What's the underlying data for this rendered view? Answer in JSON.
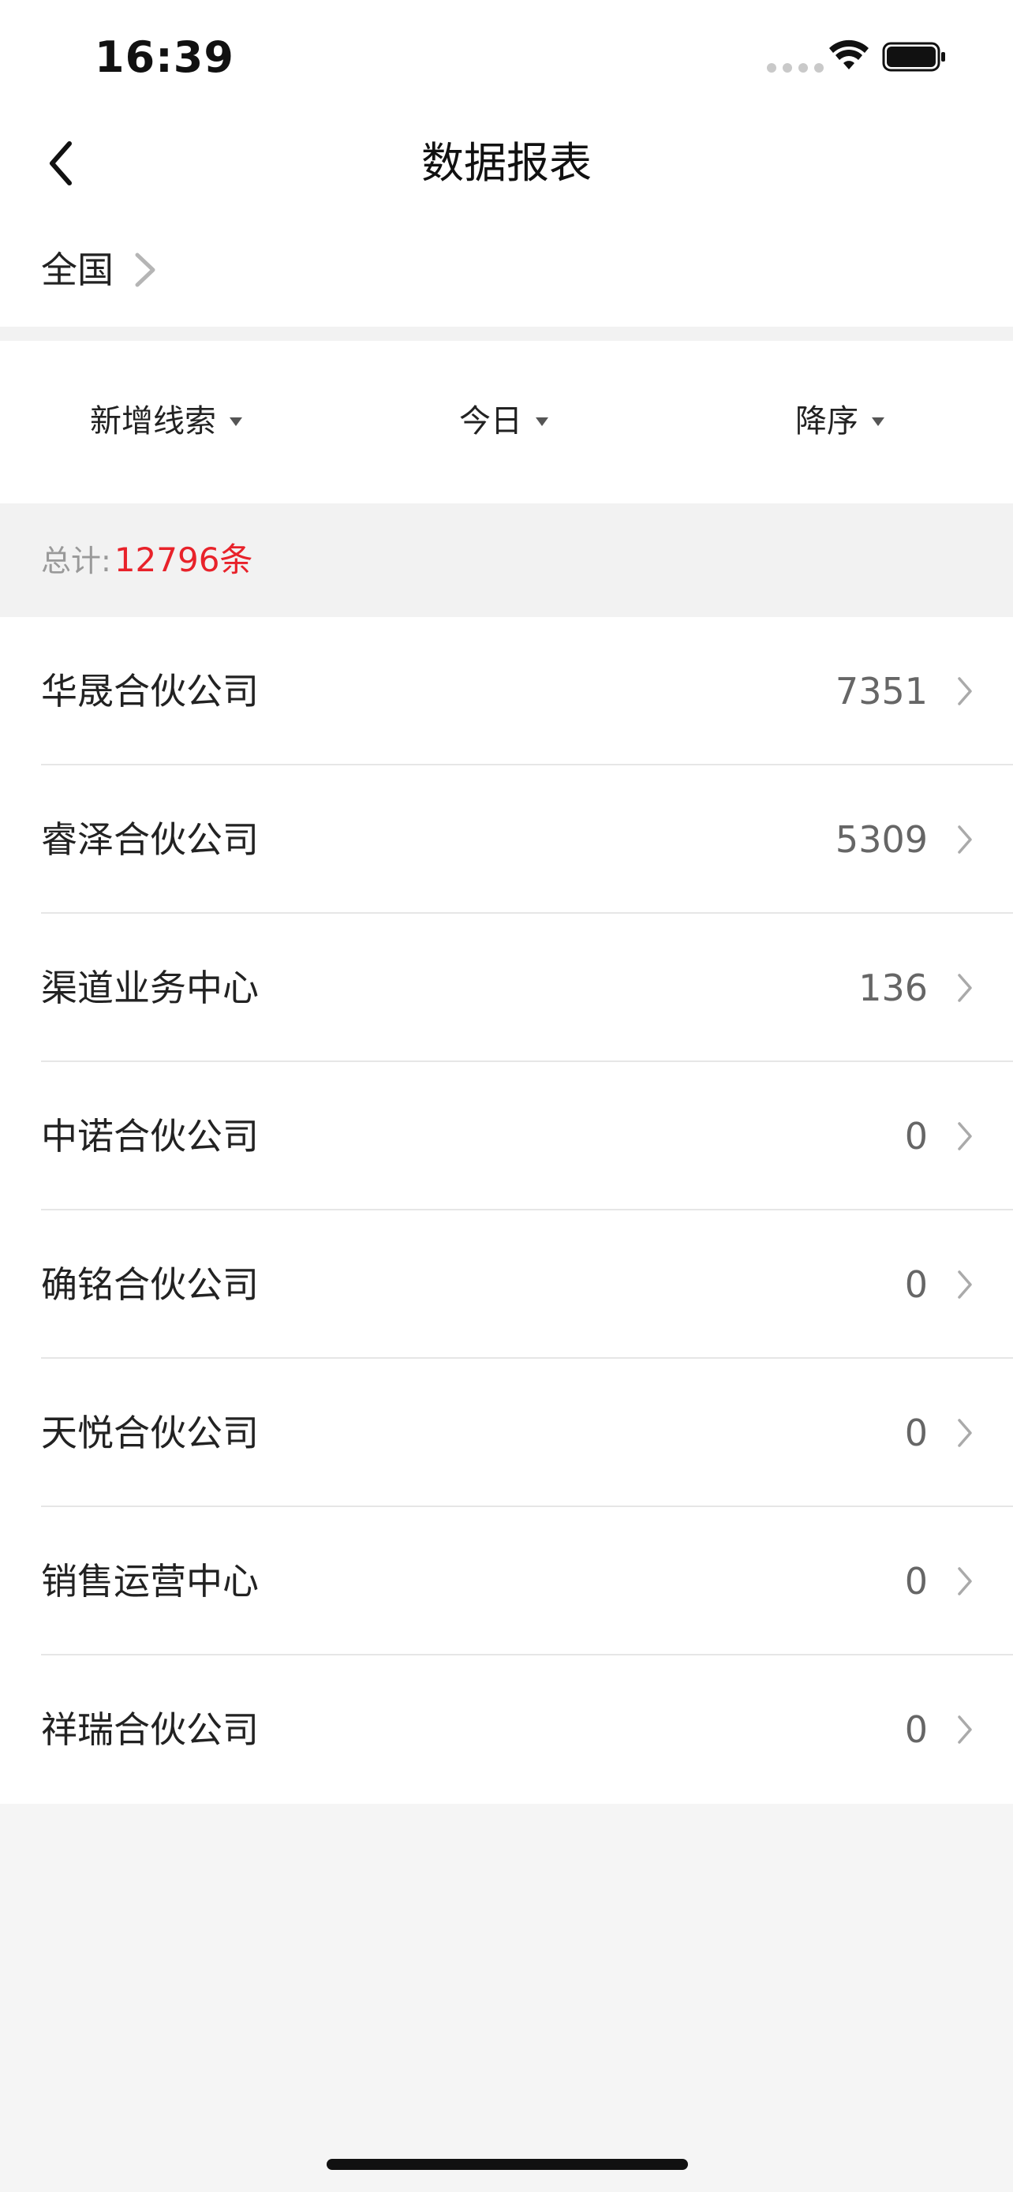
{
  "status_bar": {
    "time": "16:39"
  },
  "nav": {
    "title": "数据报表",
    "back_icon": "chevron-left-icon"
  },
  "region": {
    "label": "全国",
    "icon": "chevron-right-icon"
  },
  "filters": [
    {
      "label": "新增线索",
      "icon": "caret-down-icon"
    },
    {
      "label": "今日",
      "icon": "caret-down-icon"
    },
    {
      "label": "降序",
      "icon": "caret-down-icon"
    }
  ],
  "total": {
    "label": "总计:",
    "value": "12796条"
  },
  "items": [
    {
      "name": "华晟合伙公司",
      "value": "7351"
    },
    {
      "name": "睿泽合伙公司",
      "value": "5309"
    },
    {
      "name": "渠道业务中心",
      "value": "136"
    },
    {
      "name": "中诺合伙公司",
      "value": "0"
    },
    {
      "name": "确铭合伙公司",
      "value": "0"
    },
    {
      "name": "天悦合伙公司",
      "value": "0"
    },
    {
      "name": "销售运营中心",
      "value": "0"
    },
    {
      "name": "祥瑞合伙公司",
      "value": "0"
    }
  ],
  "colors": {
    "accent_red": "#e8222a",
    "background": "#f5f5f5",
    "text_primary": "#222222",
    "text_secondary": "#666666",
    "text_muted": "#999999"
  }
}
